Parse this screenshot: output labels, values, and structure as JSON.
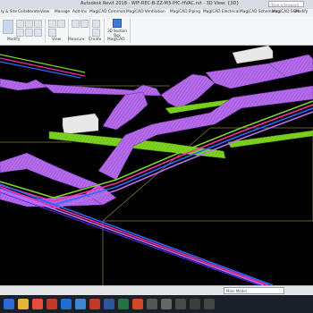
{
  "window": {
    "title": "Autodesk Revit 2018 -  WIF-REC-B-ZZ-M3-IHC-HVAC.rvt - 3D View: {3D}",
    "search_placeholder": "Type a keyword or phrase"
  },
  "ribbon_tabs": [
    "ly & Site",
    "Collaborate",
    "View",
    "Manage",
    "Add-Ins",
    "MagiCAD Common",
    "MagiCAD Ventilation",
    "MagiCAD Piping",
    "MagiCAD Electrical",
    "MagiCAD Schematics",
    "MagiCAD S&H",
    "Modify"
  ],
  "ribbon_groups": {
    "modify": "Modify",
    "view": "View",
    "measure": "Measure",
    "create": "Create",
    "magicad": "MagiCAD"
  },
  "section_box_label": "3D Section Box",
  "status_bar": {
    "model_selector": "Main Model"
  },
  "taskbar_icons": [
    "windows-start",
    "file-explorer",
    "chrome",
    "opera",
    "outlook",
    "revit",
    "pdf",
    "word",
    "excel",
    "powerpoint",
    "app-9",
    "app-10",
    "app-11",
    "app-12",
    "app-13"
  ],
  "colors": {
    "duct": "#b96ef0",
    "pipe_green": "#7ed321",
    "pipe_magenta": "#ff2aa8",
    "pipe_blue": "#2b6bff",
    "section_box_edge": "#8a7a3a"
  }
}
